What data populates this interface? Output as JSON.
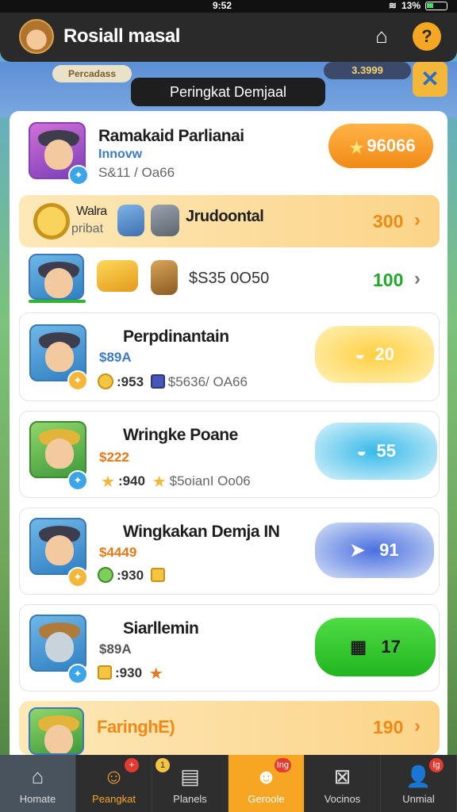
{
  "status": {
    "time": "9:52",
    "battery": "13%"
  },
  "header": {
    "title": "Rosiall masal",
    "help_label": "?"
  },
  "background": {
    "tag": "Percadass",
    "coins": "3.3999"
  },
  "panel_title": "Peringkat Demjaal",
  "rows": [
    {
      "name": "Ramakaid Parlianai",
      "sub": "Innovw",
      "meta": "S&11 / Oa66",
      "score": "96066"
    },
    {
      "label_top": "Walra",
      "label_bottom": "pribat",
      "name": "Jrudoontal",
      "score": "300"
    },
    {
      "meta": "$S35 0O50",
      "score": "100"
    },
    {
      "name": "Perpdinantain",
      "sub": "$89A",
      "meta_a": ":953",
      "meta_b": "$5636/ OA66",
      "score": "20"
    },
    {
      "name": "Wringke Poane",
      "sub": "$222",
      "meta_a": ":940",
      "meta_b": "$5oianI Oo06",
      "score": "55"
    },
    {
      "name": "Wingkakan Demja  IN",
      "sub": "$4449",
      "meta_a": ":930",
      "score": "91"
    },
    {
      "name": "Siarllemin",
      "sub": "$89A",
      "meta_a": ":930",
      "score": "17"
    },
    {
      "name": "FaringhE)",
      "score": "190"
    }
  ],
  "nav": [
    {
      "label": "Homate",
      "icon": "home-icon"
    },
    {
      "label": "Peangkat",
      "icon": "hero-icon",
      "badge": "+"
    },
    {
      "label": "Planels",
      "icon": "clipboard-icon",
      "badge": "1"
    },
    {
      "label": "Geroole",
      "icon": "character-icon",
      "badge": "Ing"
    },
    {
      "label": "Vocinos",
      "icon": "map-icon"
    },
    {
      "label": "Unmial",
      "icon": "profile-icon",
      "badge": "Ig"
    }
  ]
}
